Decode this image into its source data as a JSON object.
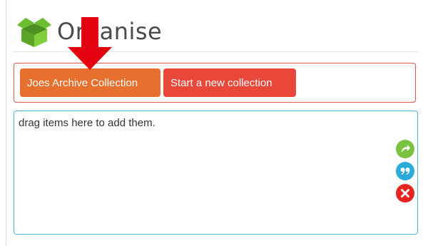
{
  "header": {
    "title": "Organise",
    "logo_icon": "green-box-icon"
  },
  "collections": {
    "active_label": "Joes Archive Collection",
    "new_label": "Start a new collection"
  },
  "drop_zone": {
    "placeholder_text": "drag items here to add them."
  },
  "actions": [
    {
      "name": "share-icon",
      "color": "#7cc242"
    },
    {
      "name": "quote-icon",
      "color": "#2ba9d9"
    },
    {
      "name": "delete-icon",
      "color": "#e52421"
    }
  ],
  "colors": {
    "active_button": "#e8702e",
    "new_button": "#e8473a",
    "collections_border": "#e8554a",
    "drop_zone_border": "#48b4de",
    "annotation_arrow": "#e3000f"
  }
}
